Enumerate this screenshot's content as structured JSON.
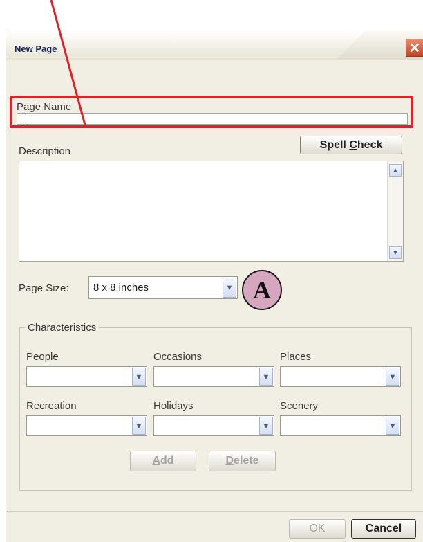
{
  "dialog": {
    "title": "New Page",
    "close_glyph": "✕"
  },
  "page_name": {
    "label": "Page Name",
    "value": ""
  },
  "description": {
    "label": "Description",
    "value": ""
  },
  "spell_check": {
    "label_prefix": "Spell ",
    "label_mnemonic": "C",
    "label_suffix": "heck"
  },
  "page_size": {
    "label": "Page Size:",
    "selected": "8 x 8 inches"
  },
  "characteristics": {
    "title": "Characteristics",
    "fields": [
      {
        "label": "People",
        "value": ""
      },
      {
        "label": "Occasions",
        "value": ""
      },
      {
        "label": "Places",
        "value": ""
      },
      {
        "label": "Recreation",
        "value": ""
      },
      {
        "label": "Holidays",
        "value": ""
      },
      {
        "label": "Scenery",
        "value": ""
      }
    ]
  },
  "add_button": {
    "mnemonic": "A",
    "rest": "dd"
  },
  "delete_button": {
    "mnemonic": "D",
    "rest": "elete"
  },
  "ok_button": {
    "label": "OK"
  },
  "cancel_button": {
    "label": "Cancel"
  },
  "callout": {
    "letter": "A",
    "color": "#d6a5be"
  },
  "annotation": {
    "highlight_color": "#e0202a"
  }
}
